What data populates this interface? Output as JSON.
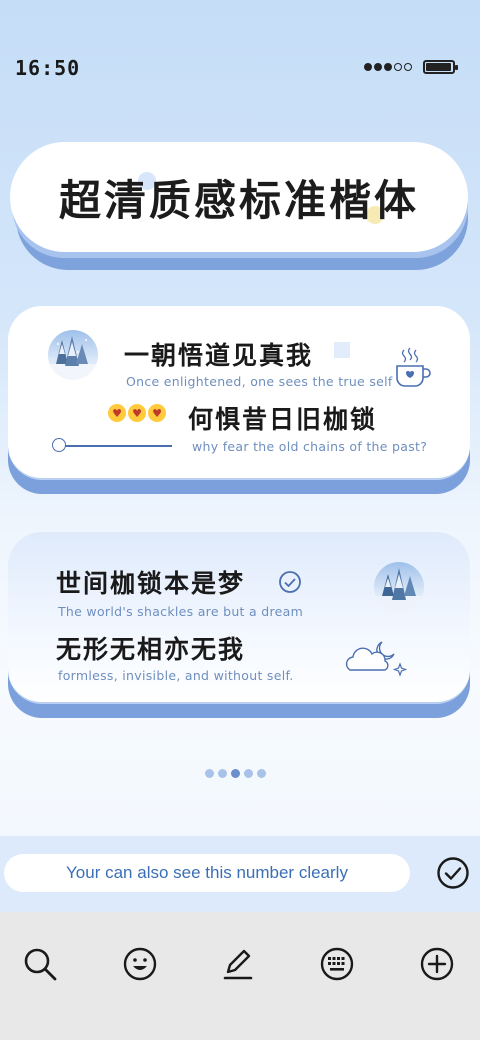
{
  "status_bar": {
    "time": "16:50",
    "signal_level": 3,
    "signal_total": 5,
    "battery_level": 0.9,
    "battery-icon": "battery-icon"
  },
  "title": {
    "text": "超清质感标准楷体"
  },
  "card1": {
    "line1_cn": "一朝悟道见真我",
    "line1_en": "Once enlightened, one sees the true self",
    "line2_cn": "何惧昔日旧枷锁",
    "line2_en": "why fear the old chains of the past?",
    "icons": [
      "snow-tree-avatar",
      "coffee-cup-icon",
      "kiss-emoji",
      "kiss-emoji",
      "kiss-emoji",
      "slider"
    ]
  },
  "card2": {
    "line1_cn": "世间枷锁本是梦",
    "line1_en": "The world's shackles are but a dream",
    "line2_cn": "无形无相亦无我",
    "line2_en": "formless, invisible, and without self.",
    "icons": [
      "check-circle-icon",
      "snow-tree-avatar",
      "cloud-moon-icon"
    ]
  },
  "pager": {
    "count": 5,
    "active_index": 2
  },
  "input": {
    "text": "Your can also see this number clearly"
  },
  "toolbar": {
    "items": [
      "search-icon",
      "emoji-icon",
      "pen-icon",
      "keyboard-icon",
      "add-icon"
    ]
  },
  "colors": {
    "accent": "#3b6fb5",
    "card_shadow": "#7ca0dc",
    "english_text": "#6f8fbf"
  }
}
